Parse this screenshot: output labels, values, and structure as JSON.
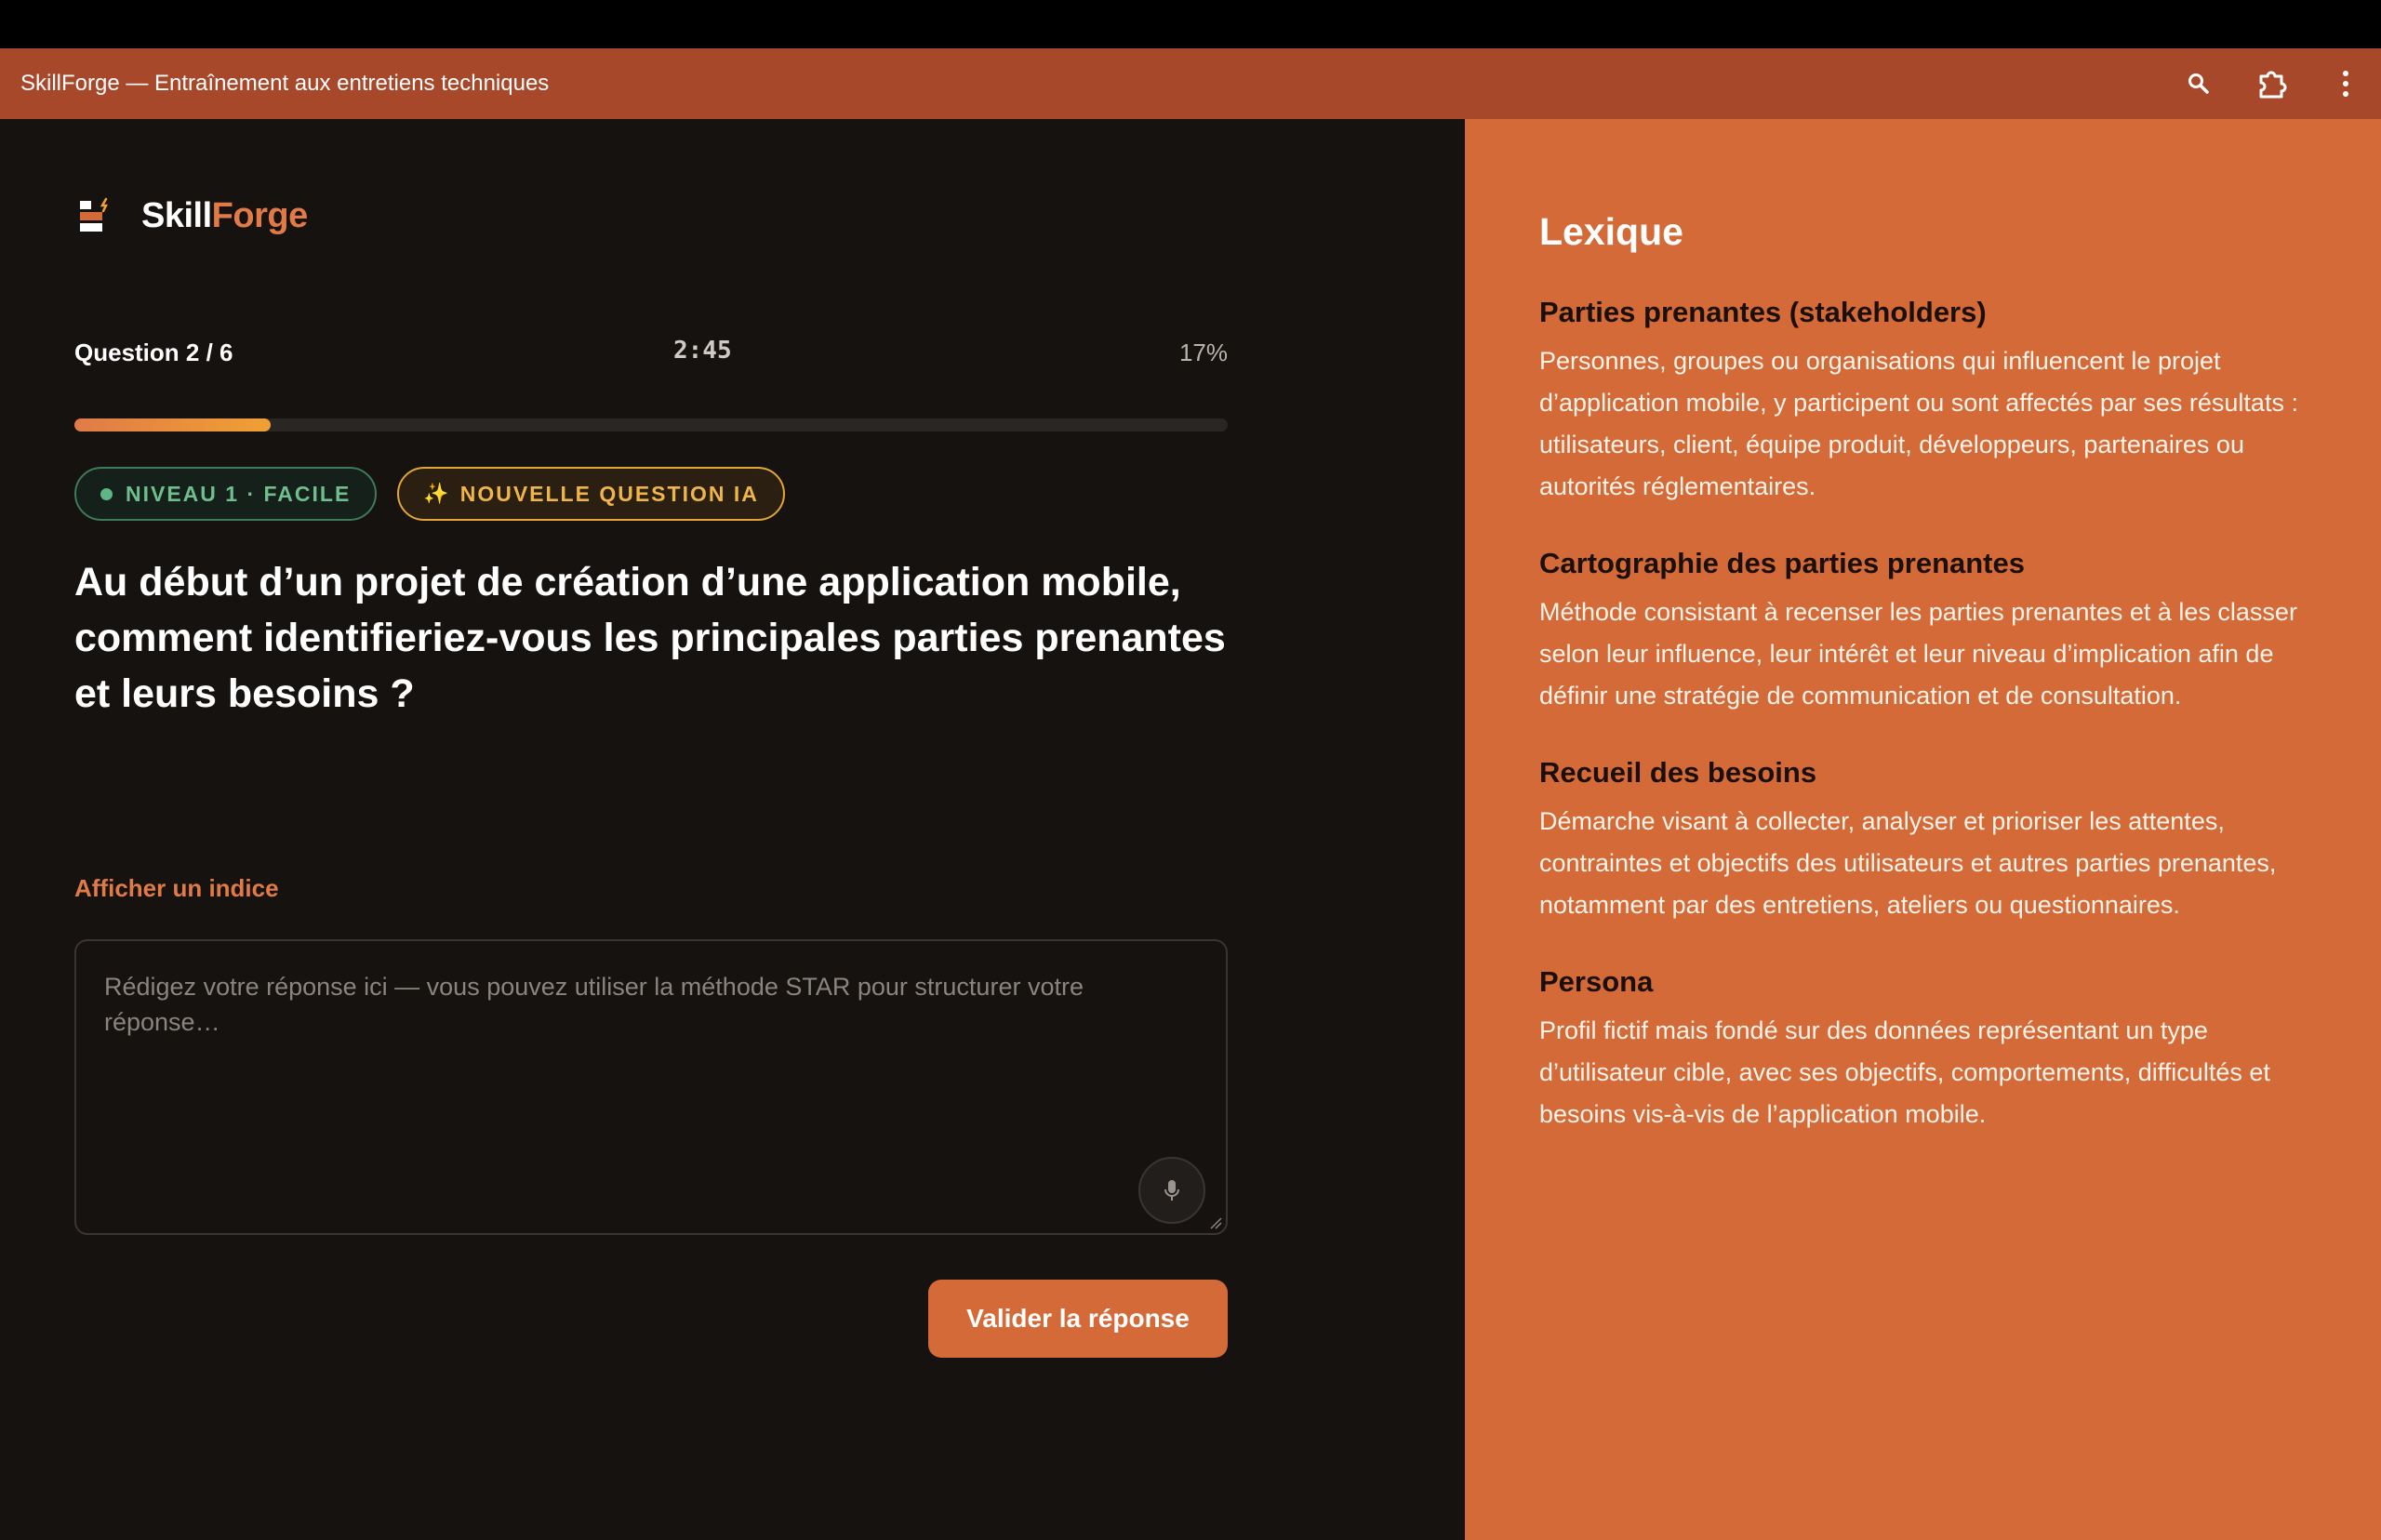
{
  "window": {
    "title": "SkillForge — Entraînement aux entretiens techniques",
    "icons": [
      "search-icon",
      "extension-icon",
      "more-vert-icon"
    ]
  },
  "brand": {
    "name_part1": "Skill",
    "name_part2": "Forge"
  },
  "quiz": {
    "question_label": "Question 2 / 6",
    "timer": "2:45",
    "progress_label": "17%",
    "progress_fraction": 0.17,
    "level_badge": "NIVEAU 1 · FACILE",
    "ai_badge": "NOUVELLE QUESTION IA",
    "question": "Au début d’un projet de création d’une application mobile, comment identifieriez-vous les principales parties prenantes et leurs besoins ?",
    "hint_link": "Afficher un indice",
    "answer_placeholder": "Rédigez votre réponse ici — vous pouvez utiliser la méthode STAR pour structurer votre réponse…",
    "answer_value": "",
    "submit_label": "Valider la réponse"
  },
  "glossary": {
    "title": "Lexique",
    "terms": [
      {
        "term": "Parties prenantes (stakeholders)",
        "definition": "Personnes, groupes ou organisations qui influencent le projet d’application mobile, y participent ou sont affectés par ses résultats : utilisateurs, client, équipe produit, développeurs, partenaires ou autorités réglementaires."
      },
      {
        "term": "Cartographie des parties prenantes",
        "definition": "Méthode consistant à recenser les parties prenantes et à les classer selon leur influence, leur intérêt et leur niveau d’implication afin de définir une stratégie de communication et de consultation."
      },
      {
        "term": "Recueil des besoins",
        "definition": "Démarche visant à collecter, analyser et prioriser les attentes, contraintes et objectifs des utilisateurs et autres parties prenantes, notamment par des entretiens, ateliers ou questionnaires."
      },
      {
        "term": "Persona",
        "definition": "Profil fictif mais fondé sur des données représentant un type d’utilisateur cible, avec ses objectifs, comportements, difficultés et besoins vis-à-vis de l’application mobile."
      }
    ]
  },
  "colors": {
    "accent": "#d46a37",
    "titlebar": "#a8482a",
    "panel_dark": "#161210",
    "level_green": "#6fbf8e",
    "ai_gold": "#f0b54a"
  }
}
